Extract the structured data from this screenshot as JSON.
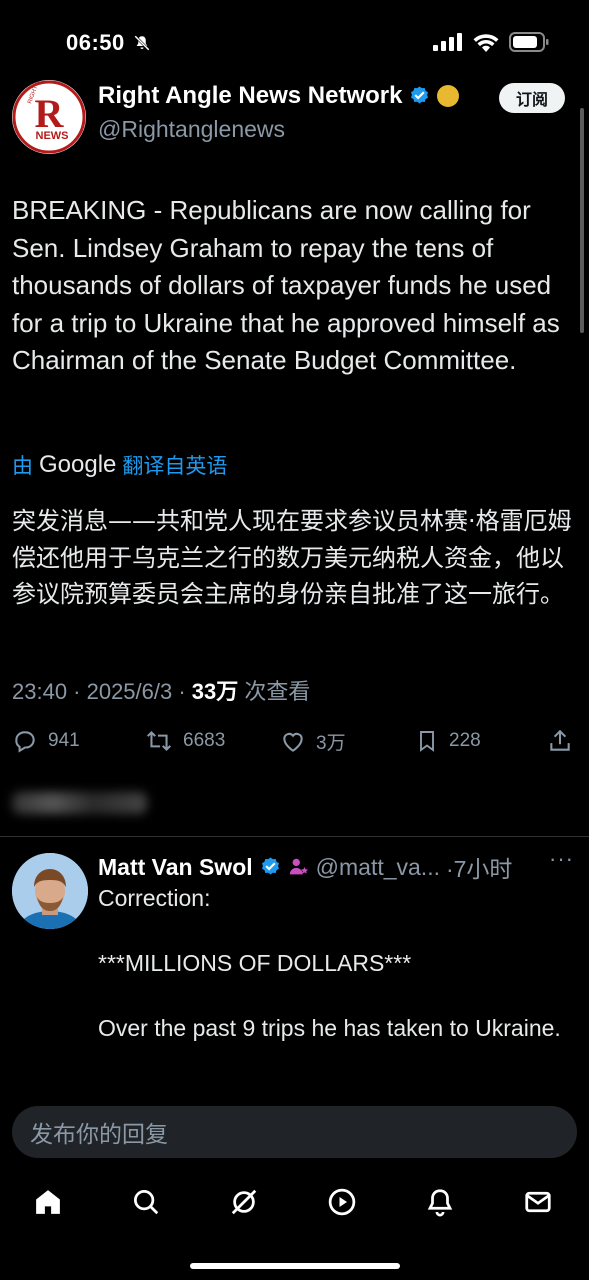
{
  "status_bar": {
    "time": "06:50"
  },
  "tweet": {
    "author_name": "Right Angle News Network",
    "author_handle": "@Rightanglenews",
    "subscribe_label": "订阅",
    "avatar_text_top": "RIGHT ANGLE",
    "avatar_letter": "R",
    "avatar_text_bottom": "NEWS",
    "text": "BREAKING - Republicans are now calling for Sen. Lindsey Graham to repay the tens of thousands of dollars of taxpayer funds he used for a trip to Ukraine that he approved himself as Chairman of the Senate Budget Committee.",
    "translate_prefix": "由",
    "translate_brand": "Google",
    "translate_suffix": "翻译自英语",
    "translated_text": "突发消息——共和党人现在要求参议员林赛·格雷厄姆偿还他用于乌克兰之行的数万美元纳税人资金，他以参议院预算委员会主席的身份亲自批准了这一旅行。",
    "timestamp": "23:40 · 2025/6/3 · ",
    "views_count": "33万",
    "views_label": " 次查看",
    "replies": "941",
    "retweets": "6683",
    "likes": "3万",
    "bookmarks": "228"
  },
  "reply": {
    "author_name": "Matt Van Swol",
    "author_handle": "@matt_va...",
    "time": "·7小时",
    "more": "···",
    "lines": [
      "Correction:",
      "***MILLIONS OF DOLLARS***",
      "Over the past 9 trips he has taken to Ukraine."
    ]
  },
  "compose": {
    "placeholder": "发布你的回复"
  },
  "colors": {
    "accent": "#1d9bf0",
    "verified": "#1d9bf0",
    "gold_badge": "#e8b830",
    "secondary_text": "#8b98a5"
  },
  "icons": {
    "status": [
      "mute-bell-icon",
      "signal-icon",
      "wifi-icon",
      "battery-icon"
    ],
    "actions": [
      "reply-icon",
      "retweet-icon",
      "like-icon",
      "bookmark-icon",
      "share-icon"
    ],
    "tabs": [
      "home-icon",
      "search-icon",
      "grok-icon",
      "video-icon",
      "notifications-icon",
      "messages-icon"
    ]
  }
}
